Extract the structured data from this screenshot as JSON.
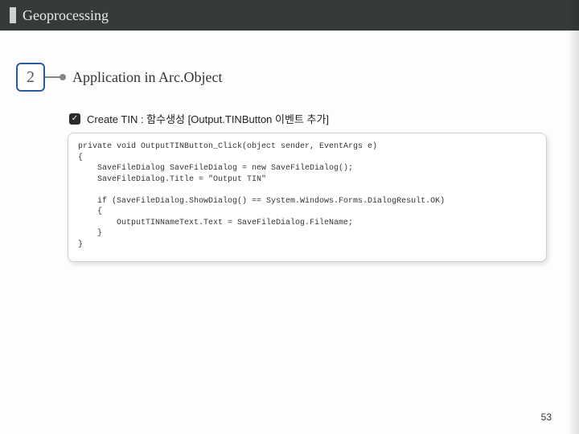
{
  "header": {
    "title": "Geoprocessing"
  },
  "section": {
    "number": "2",
    "title": "Application in Arc.Object"
  },
  "subsection": {
    "check": "✓",
    "text": "Create TIN : 함수생성 [Output.TINButton 이벤트 추가]"
  },
  "code": "private void OutputTINButton_Click(object sender, EventArgs e)\n{\n    SaveFileDialog SaveFileDialog = new SaveFileDialog();\n    SaveFileDialog.Title = \"Output TIN\"\n\n    if (SaveFileDialog.ShowDialog() == System.Windows.Forms.DialogResult.OK)\n    {\n        OutputTINNameText.Text = SaveFileDialog.FileName;\n    }\n}",
  "page_number": "53"
}
